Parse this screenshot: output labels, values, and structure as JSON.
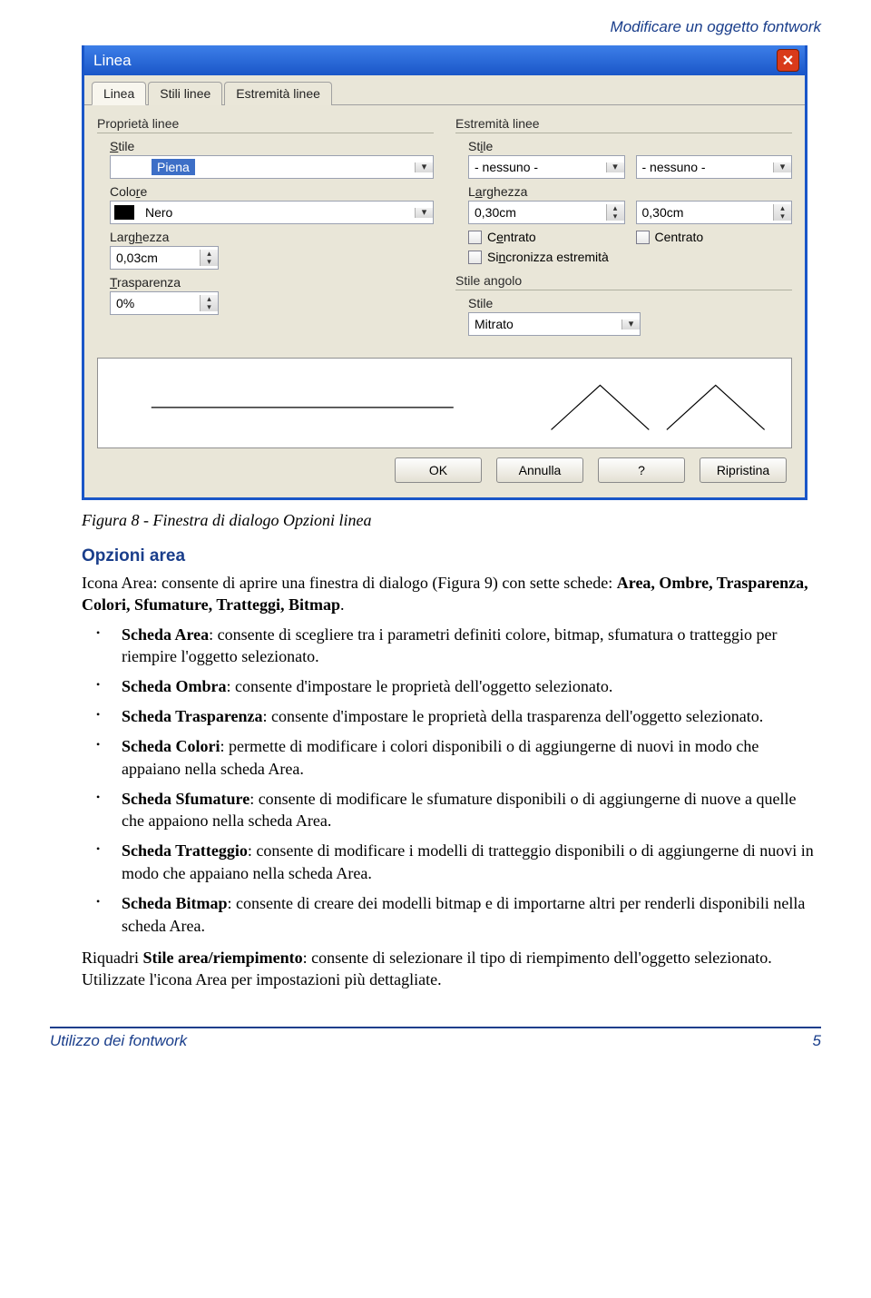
{
  "header_right": "Modificare un oggetto fontwork",
  "dialog": {
    "title": "Linea",
    "tabs": [
      "Linea",
      "Stili linee",
      "Estremità linee"
    ],
    "left": {
      "group": "Proprietà linee",
      "stile_lbl": "Stile",
      "stile_val": "Piena",
      "colore_lbl": "Colore",
      "colore_val": "Nero",
      "largh_lbl": "Larghezza",
      "largh_val": "0,03cm",
      "trasp_lbl": "Trasparenza",
      "trasp_val": "0%"
    },
    "right": {
      "group": "Estremità linee",
      "stile_lbl": "Stile",
      "stile_val1": "- nessuno -",
      "stile_val2": "- nessuno -",
      "largh_lbl": "Larghezza",
      "largh_val1": "0,30cm",
      "largh_val2": "0,30cm",
      "centrato1": "Centrato",
      "centrato2": "Centrato",
      "sync": "Sincronizza estremità"
    },
    "corner": {
      "group": "Stile angolo",
      "stile_lbl": "Stile",
      "stile_val": "Mitrato"
    },
    "buttons": {
      "ok": "OK",
      "cancel": "Annulla",
      "help": "?",
      "reset": "Ripristina"
    }
  },
  "caption": "Figura 8 - Finestra di dialogo Opzioni linea",
  "sec_title": "Opzioni area",
  "intro": {
    "pre": "Icona Area: consente di aprire una finestra di dialogo (Figura 9) con sette schede: ",
    "bold": "Area, Ombre, Trasparenza, Colori, Sfumature, Tratteggi, Bitmap",
    "post": "."
  },
  "bullets": [
    {
      "b": "Scheda Area",
      "t": ": consente di scegliere tra i parametri definiti colore, bitmap, sfumatura o tratteggio per riempire l'oggetto selezionato."
    },
    {
      "b": "Scheda Ombra",
      "t": ": consente d'impostare le proprietà dell'oggetto selezionato."
    },
    {
      "b": "Scheda Trasparenza",
      "t": ": consente d'impostare le proprietà della trasparenza dell'oggetto selezionato."
    },
    {
      "b": "Scheda Colori",
      "t": ": permette di modificare i colori disponibili o di aggiungerne di nuovi in modo che appaiano nella scheda Area."
    },
    {
      "b": "Scheda Sfumature",
      "t": ": consente di modificare le sfumature disponibili o di aggiungerne di nuove a quelle che appaiono nella scheda Area."
    },
    {
      "b": "Scheda Tratteggio",
      "t": ": consente di modificare i modelli di tratteggio disponibili o di aggiungerne di nuovi in modo che appaiano nella scheda Area."
    },
    {
      "b": "Scheda Bitmap",
      "t": ": consente di creare dei modelli bitmap e di importarne altri per renderli disponibili nella scheda Area."
    }
  ],
  "closing": {
    "pre": "Riquadri ",
    "bold": "Stile area/riempimento",
    "post": ": consente di selezionare il tipo di riempimento dell'oggetto selezionato. Utilizzate l'icona Area per impostazioni più dettagliate."
  },
  "footer": {
    "left": "Utilizzo dei fontwork",
    "right": "5"
  }
}
